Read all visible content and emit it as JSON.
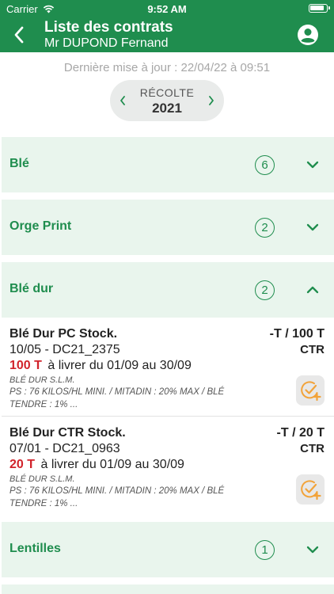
{
  "status_bar": {
    "carrier": "Carrier",
    "time": "9:52 AM"
  },
  "header": {
    "title": "Liste des contrats",
    "subtitle": "Mr DUPOND Fernand"
  },
  "last_update": "Dernière mise à jour : 22/04/22 à 09:51",
  "season": {
    "label": "RÉCOLTE",
    "year": "2021"
  },
  "colors": {
    "brand": "#1f8d4e",
    "section_bg": "#e9f5ed",
    "quantity_red": "#d1232b",
    "action_orange": "#f2a33a"
  },
  "sections": [
    {
      "name": "Blé",
      "count": "6",
      "expanded": false
    },
    {
      "name": "Orge Print",
      "count": "2",
      "expanded": false
    },
    {
      "name": "Blé dur",
      "count": "2",
      "expanded": true
    },
    {
      "name": "Lentilles",
      "count": "1",
      "expanded": false
    }
  ],
  "contracts": [
    {
      "name": "Blé Dur PC Stock.",
      "ref": "10/05 - DC21_2375",
      "quantity": "100 T",
      "delivery": "à livrer du 01/09 au 30/09",
      "supplier": "BLÉ DUR S.L.M.",
      "notes": "PS : 76 KILOS/HL MINI. / MITADIN : 20% MAX / BLÉ TENDRE : 1% ...",
      "amount": "-T / 100 T",
      "type": "CTR",
      "action_icon": "check-add-icon"
    },
    {
      "name": "Blé Dur CTR Stock.",
      "ref": "07/01 - DC21_0963",
      "quantity": "20 T",
      "delivery": "à livrer du 01/09 au 30/09",
      "supplier": "BLÉ DUR S.L.M.",
      "notes": "PS : 76 KILOS/HL MINI. / MITADIN : 20% MAX / BLÉ TENDRE : 1% ...",
      "amount": "-T / 20 T",
      "type": "CTR",
      "action_icon": "check-add-icon"
    }
  ]
}
